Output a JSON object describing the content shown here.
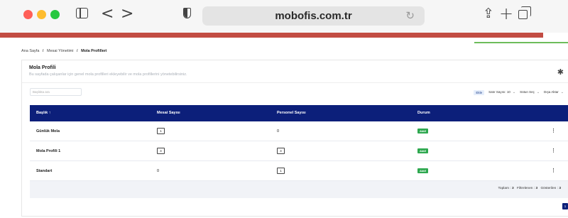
{
  "browser": {
    "url": "mobofis.com.tr"
  },
  "breadcrumb": {
    "items": [
      "Ana Sayfa",
      "Mesai Yönetimi",
      "Mola Profilleri"
    ],
    "separator": "/"
  },
  "page": {
    "title": "Mola Profili",
    "subtitle": "Bu sayfada çalışanlar için genel mola profilleri ekleyebilir ve mola profillerini yönetebilirsiniz."
  },
  "search": {
    "placeholder": "Başlıkta ara"
  },
  "toolbar": {
    "add_label": "Ekle",
    "rows_label": "Satır Sayısı: 10",
    "columns_label": "Sütun Seç",
    "export_label": "Dışa Aktar"
  },
  "table": {
    "headers": [
      "Başlık ↑",
      "Mesai Sayısı",
      "Personel Sayısı",
      "Durum"
    ],
    "rows": [
      {
        "title": "Günlük Mola",
        "shift_count": "1",
        "personnel_count": "0",
        "status": "Aktif"
      },
      {
        "title": "Mola Profili 1",
        "shift_count": "4",
        "personnel_count": "4",
        "status": "Aktif"
      },
      {
        "title": "Standart",
        "shift_count": "0",
        "personnel_count": "1",
        "status": "Aktif"
      }
    ]
  },
  "summary": {
    "total_label": "Toplam :",
    "total": "3",
    "filtered_label": "Filtrelenen :",
    "filtered": "3",
    "shown_label": "Gösterilen :",
    "shown": "3"
  },
  "pagination": {
    "current": "1"
  },
  "colors": {
    "accent": "#c24c43",
    "header_bg": "#0c1f7a",
    "status_active": "#2ea84f"
  },
  "icons": [
    "sidebar-icon",
    "back-icon",
    "forward-icon",
    "shield-icon",
    "reload-icon",
    "share-icon",
    "new-tab-icon",
    "tabs-icon",
    "gear-icon",
    "kebab-menu-icon",
    "caret-down-icon"
  ]
}
